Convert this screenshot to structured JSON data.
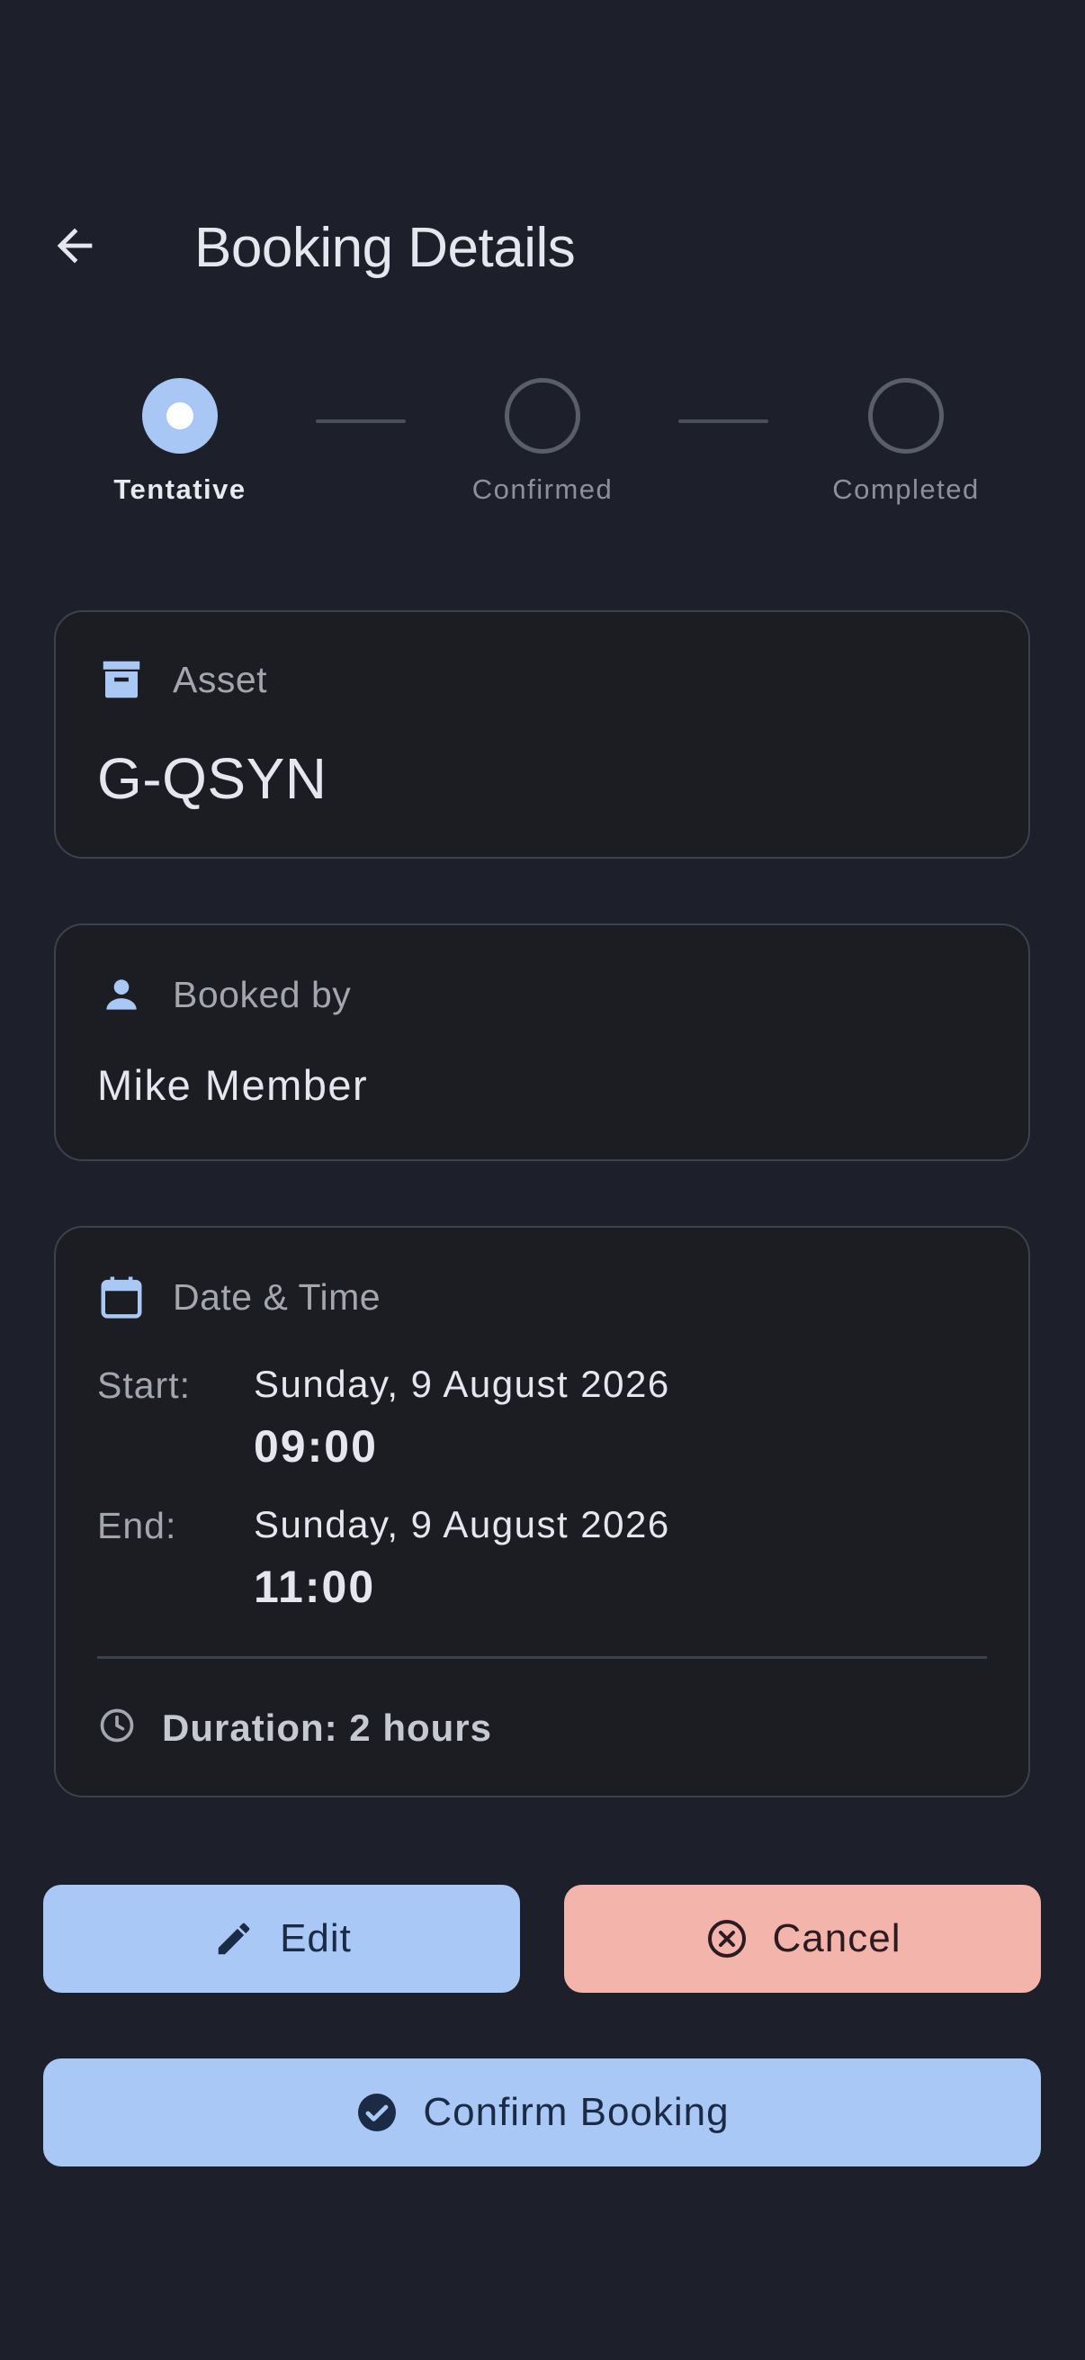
{
  "header": {
    "title": "Booking Details",
    "back_icon": "arrow-left-icon"
  },
  "stepper": {
    "steps": [
      {
        "label": "Tentative",
        "state": "active"
      },
      {
        "label": "Confirmed",
        "state": "inactive"
      },
      {
        "label": "Completed",
        "state": "inactive"
      }
    ]
  },
  "asset": {
    "label": "Asset",
    "value": "G-QSYN",
    "icon": "archive-box-icon"
  },
  "booked_by": {
    "label": "Booked by",
    "value": "Mike Member",
    "icon": "person-icon"
  },
  "datetime": {
    "label": "Date & Time",
    "icon": "calendar-icon",
    "start": {
      "key": "Start:",
      "date": "Sunday, 9 August 2026",
      "time": "09:00"
    },
    "end": {
      "key": "End:",
      "date": "Sunday, 9 August 2026",
      "time": "11:00"
    },
    "duration": "Duration: 2 hours",
    "duration_icon": "clock-icon"
  },
  "actions": {
    "edit_label": "Edit",
    "cancel_label": "Cancel",
    "confirm_label": "Confirm Booking"
  },
  "colors": {
    "background": "#1d202b",
    "primary": "#a9c8f5",
    "danger": "#f3b4ab",
    "card_border": "#3d414b"
  }
}
